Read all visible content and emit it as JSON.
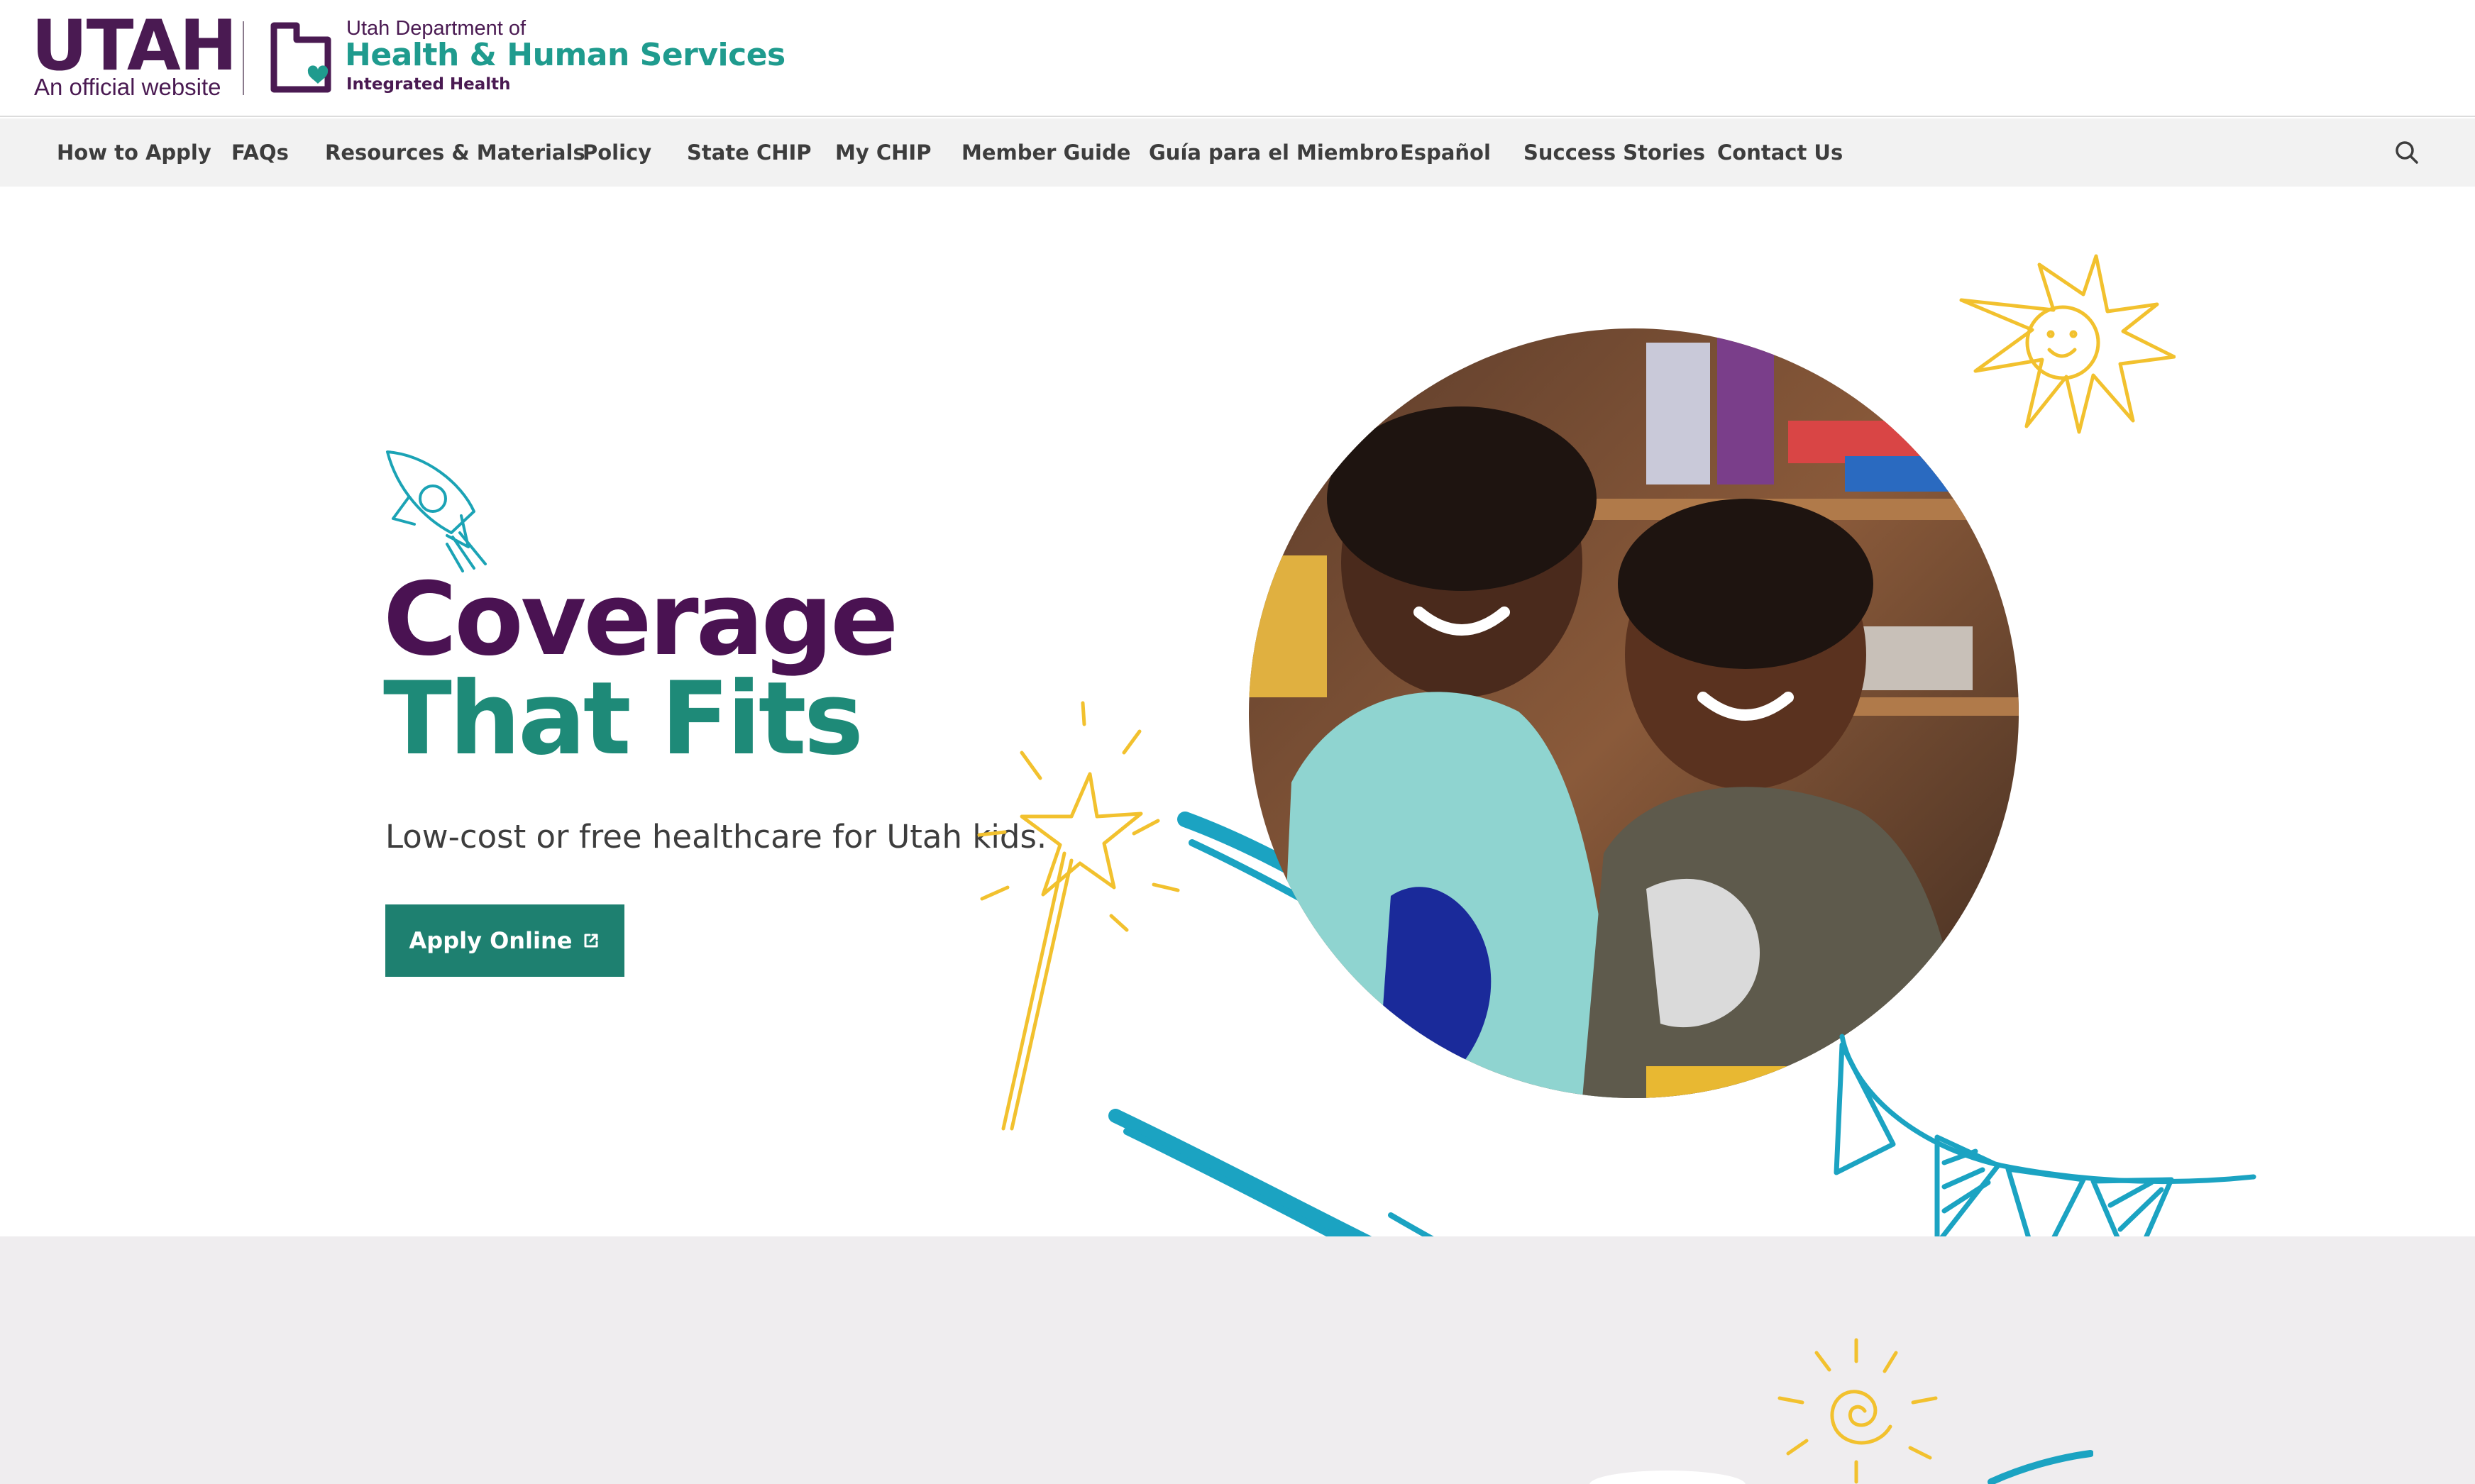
{
  "header": {
    "state_logo": "UTAH",
    "state_tagline": "An official website",
    "dept_prefix": "Utah Department of",
    "dept_name": "Health & Human Services",
    "dept_division": "Integrated Health"
  },
  "nav": {
    "items": [
      "How to Apply",
      "FAQs",
      "Resources & Materials",
      "Policy",
      "State CHIP",
      "My CHIP",
      "Member Guide",
      "Guía para el Miembro",
      "Español",
      "Success Stories",
      "Contact Us"
    ],
    "search_icon": "search-icon"
  },
  "hero": {
    "title_line1": "Coverage",
    "title_line2": "That Fits",
    "subtitle": "Low-cost or free healthcare for Utah kids.",
    "cta_label": "Apply Online",
    "cta_icon": "external-link-icon"
  },
  "colors": {
    "brand_purple": "#4a1252",
    "brand_teal": "#1e8a78",
    "button_teal": "#1e8070",
    "doodle_yellow": "#f2c12e",
    "doodle_blue": "#1ba3c2",
    "nav_bg": "#f2f2f2",
    "lower_band_bg": "#efedef"
  }
}
